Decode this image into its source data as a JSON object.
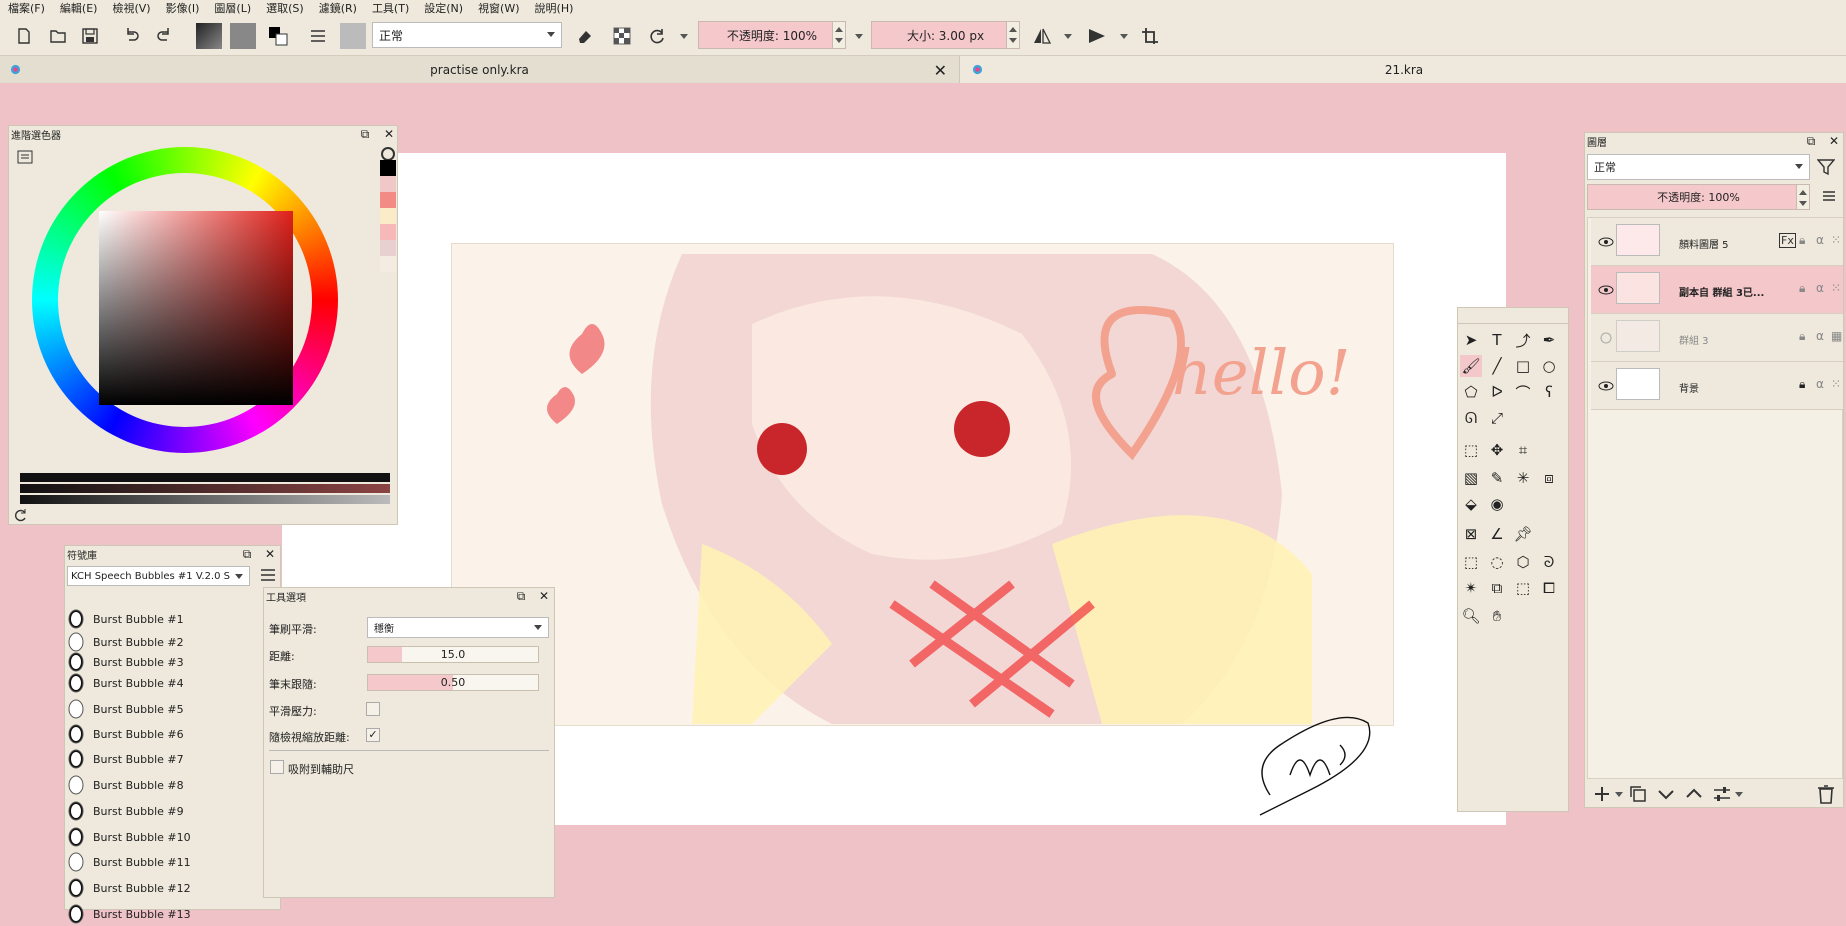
{
  "menu": [
    "檔案(F)",
    "編輯(E)",
    "檢視(V)",
    "影像(I)",
    "圖層(L)",
    "選取(S)",
    "濾鏡(R)",
    "工具(T)",
    "設定(N)",
    "視窗(W)",
    "說明(H)"
  ],
  "toolbar": {
    "blend_mode": "正常",
    "opacity": "不透明度: 100%",
    "size": "大小: 3.00 px"
  },
  "tabs": [
    {
      "label": "practise only.kra",
      "close": "✕"
    },
    {
      "label": "21.kra"
    }
  ],
  "color_selector": {
    "title": "進階選色器",
    "swatches": [
      "#000000",
      "#f0c8c8",
      "#f28b86",
      "#faecc8",
      "#f6b8b8",
      "#e8d0d0",
      "#f4ebe2"
    ]
  },
  "brush_library": {
    "title": "符號庫",
    "selected": "KCH Speech Bubbles #1 V.2.0 S",
    "items": [
      "Burst Bubble #1",
      "Burst Bubble #2",
      "Burst Bubble #3",
      "Burst Bubble #4",
      "Burst Bubble #5",
      "Burst Bubble #6",
      "Burst Bubble #7",
      "Burst Bubble #8",
      "Burst Bubble #9",
      "Burst Bubble #10",
      "Burst Bubble #11",
      "Burst Bubble #12",
      "Burst Bubble #13"
    ]
  },
  "tool_options": {
    "title": "工具選項",
    "smoothing_label": "筆刷平滑:",
    "smoothing_value": "穩衡",
    "distance_label": "距離:",
    "distance_value": "15.0",
    "distance_fraction": 0.2,
    "stroke_end_label": "筆末跟隨:",
    "stroke_end_value": "0.50",
    "stroke_end_fraction": 0.5,
    "pressure_label": "平滑壓力:",
    "scale_label": "隨檢視縮放距離:",
    "scale_checked": "✓",
    "snap_label": "吸附到輔助尺"
  },
  "layers": {
    "title": "圖層",
    "blend_mode": "正常",
    "opacity": "不透明度: 100%",
    "items": [
      {
        "name": "顏料圖層 5"
      },
      {
        "name": "副本自 群組 3已..."
      },
      {
        "name": "群組 3"
      },
      {
        "name": "背景"
      }
    ]
  },
  "artwork": {
    "text": "hello!"
  }
}
